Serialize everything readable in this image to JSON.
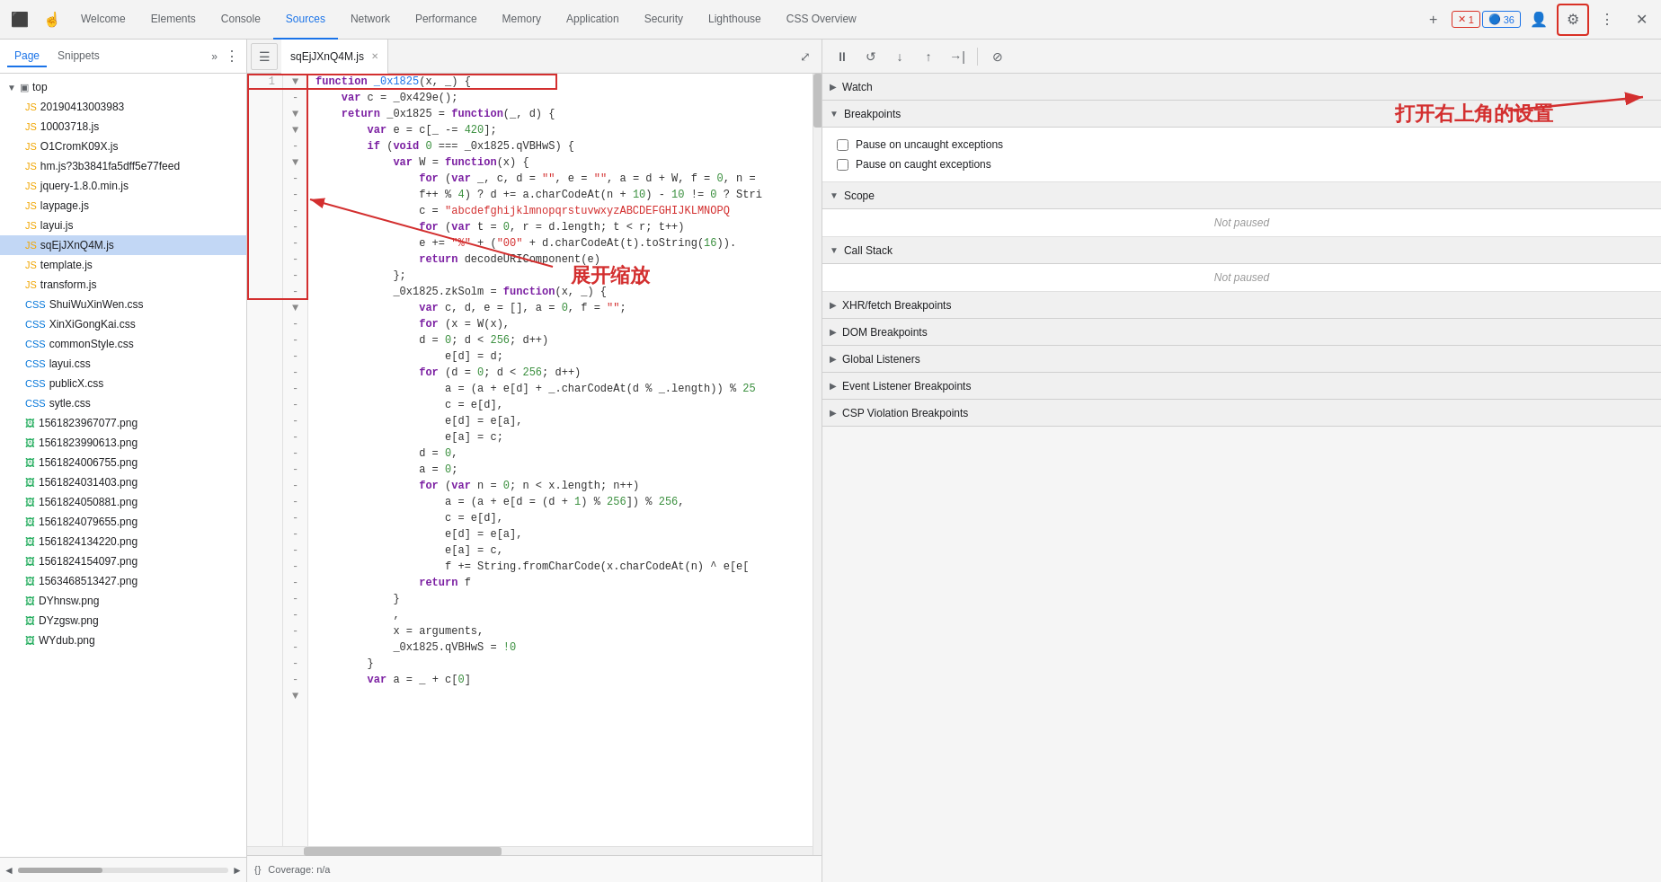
{
  "tabs": [
    {
      "label": "Welcome",
      "active": false
    },
    {
      "label": "Elements",
      "active": false
    },
    {
      "label": "Console",
      "active": false
    },
    {
      "label": "Sources",
      "active": true
    },
    {
      "label": "Network",
      "active": false
    },
    {
      "label": "Performance",
      "active": false
    },
    {
      "label": "Memory",
      "active": false
    },
    {
      "label": "Application",
      "active": false
    },
    {
      "label": "Security",
      "active": false
    },
    {
      "label": "Lighthouse",
      "active": false
    },
    {
      "label": "CSS Overview",
      "active": false
    }
  ],
  "toolbar": {
    "error_count": "1",
    "warning_count": "36"
  },
  "sidebar": {
    "tab_page": "Page",
    "tab_snippets": "Snippets",
    "root_label": "top",
    "files": [
      {
        "name": "20190413003983",
        "type": "js",
        "indent": 1
      },
      {
        "name": "10003718.js",
        "type": "js",
        "indent": 1
      },
      {
        "name": "O1CromK09X.js",
        "type": "js",
        "indent": 1
      },
      {
        "name": "hm.js?3b3841fa5dff5e77feed",
        "type": "js",
        "indent": 1
      },
      {
        "name": "jquery-1.8.0.min.js",
        "type": "js",
        "indent": 1
      },
      {
        "name": "laypage.js",
        "type": "js",
        "indent": 1
      },
      {
        "name": "layui.js",
        "type": "js",
        "indent": 1
      },
      {
        "name": "sqEjJXnQ4M.js",
        "type": "js",
        "indent": 1,
        "selected": true
      },
      {
        "name": "template.js",
        "type": "js",
        "indent": 1
      },
      {
        "name": "transform.js",
        "type": "js",
        "indent": 1
      },
      {
        "name": "ShuiWuXinWen.css",
        "type": "css",
        "indent": 1
      },
      {
        "name": "XinXiGongKai.css",
        "type": "css",
        "indent": 1
      },
      {
        "name": "commonStyle.css",
        "type": "css",
        "indent": 1
      },
      {
        "name": "layui.css",
        "type": "css",
        "indent": 1
      },
      {
        "name": "publicX.css",
        "type": "css",
        "indent": 1
      },
      {
        "name": "sytle.css",
        "type": "css",
        "indent": 1
      },
      {
        "name": "1561823967077.png",
        "type": "png",
        "indent": 1
      },
      {
        "name": "1561823990613.png",
        "type": "png",
        "indent": 1
      },
      {
        "name": "1561824006755.png",
        "type": "png",
        "indent": 1
      },
      {
        "name": "1561824031403.png",
        "type": "png",
        "indent": 1
      },
      {
        "name": "1561824050881.png",
        "type": "png",
        "indent": 1
      },
      {
        "name": "1561824079655.png",
        "type": "png",
        "indent": 1
      },
      {
        "name": "1561824134220.png",
        "type": "png",
        "indent": 1
      },
      {
        "name": "1561824154097.png",
        "type": "png",
        "indent": 1
      },
      {
        "name": "1563468513427.png",
        "type": "png",
        "indent": 1
      },
      {
        "name": "DYhnsw.png",
        "type": "png",
        "indent": 1
      },
      {
        "name": "DYzgsw.png",
        "type": "png",
        "indent": 1
      },
      {
        "name": "WYdub.png",
        "type": "png",
        "indent": 1
      }
    ]
  },
  "editor": {
    "tab_label": "sqEjJXnQ4M.js",
    "bottom_bar": "Coverage: n/a",
    "annotation_expand": "展开缩放",
    "annotation_settings": "打开右上角的设置"
  },
  "debugger": {
    "sections": {
      "watch_label": "Watch",
      "breakpoints_label": "Breakpoints",
      "pause_uncaught": "Pause on uncaught exceptions",
      "pause_caught": "Pause on caught exceptions",
      "scope_label": "Scope",
      "not_paused_1": "Not paused",
      "call_stack_label": "Call Stack",
      "not_paused_2": "Not paused",
      "xhr_label": "XHR/fetch Breakpoints",
      "dom_label": "DOM Breakpoints",
      "global_label": "Global Listeners",
      "event_label": "Event Listener Breakpoints",
      "csp_label": "CSP Violation Breakpoints"
    }
  },
  "code_lines": [
    {
      "num": "1",
      "arrow": "▼",
      "text": "function _0x1825(x, _) {"
    },
    {
      "num": "",
      "arrow": "-",
      "text": "    var c = _0x429e();"
    },
    {
      "num": "",
      "arrow": "-",
      "text": "    return _0x1825 = function(_, d) {"
    },
    {
      "num": "",
      "arrow": "▼",
      "text": "        var e = c[_ -= 420];"
    },
    {
      "num": "",
      "arrow": "-",
      "text": "        if (void 0 === _0x1825.qVBHwS) {"
    },
    {
      "num": "",
      "arrow": "▼",
      "text": "            var W = function(x) {"
    },
    {
      "num": "",
      "arrow": "-",
      "text": "                for (var _, c, d = \"\", e = \"\", a = d + W, f = 0, n ="
    },
    {
      "num": "",
      "arrow": "-",
      "text": "                f++ % 4) ? d += a.charCodeAt(n + 10) - 10 != 0 ? Stri"
    },
    {
      "num": "",
      "arrow": "-",
      "text": "                c = \"abcdefghijklmnopqrstuvwxyzABCDEFGHIJKLMNOPQ"
    },
    {
      "num": "",
      "arrow": "-",
      "text": "                for (var t = 0, r = d.length; t < r; t++)"
    },
    {
      "num": "",
      "arrow": "-",
      "text": "                e += \"%\" + (\"00\" + d.charCodeAt(t).toString(16))."
    },
    {
      "num": "",
      "arrow": "-",
      "text": "                return decodeURIComponent(e)"
    },
    {
      "num": "",
      "arrow": "-",
      "text": "            };"
    },
    {
      "num": "",
      "arrow": "-",
      "text": "            _0x1825.zkSolm = function(x, _) {"
    },
    {
      "num": "",
      "arrow": "▼",
      "text": "                var c, d, e = [], a = 0, f = \"\";"
    },
    {
      "num": "",
      "arrow": "-",
      "text": "                for (x = W(x),"
    },
    {
      "num": "",
      "arrow": "-",
      "text": "                d = 0; d < 256; d++)"
    },
    {
      "num": "",
      "arrow": "-",
      "text": "                    e[d] = d;"
    },
    {
      "num": "",
      "arrow": "-",
      "text": "                for (d = 0; d < 256; d++)"
    },
    {
      "num": "",
      "arrow": "-",
      "text": "                    a = (a + e[d] + _.charCodeAt(d % _.length)) % 25"
    },
    {
      "num": "",
      "arrow": "-",
      "text": "                    c = e[d],"
    },
    {
      "num": "",
      "arrow": "-",
      "text": "                    e[d] = e[a],"
    },
    {
      "num": "",
      "arrow": "-",
      "text": "                    e[a] = c;"
    },
    {
      "num": "",
      "arrow": "-",
      "text": "                d = 0,"
    },
    {
      "num": "",
      "arrow": "-",
      "text": "                a = 0;"
    },
    {
      "num": "",
      "arrow": "-",
      "text": "                for (var n = 0; n < x.length; n++)"
    },
    {
      "num": "",
      "arrow": "-",
      "text": "                    a = (a + e[d = (d + 1) % 256]) % 256,"
    },
    {
      "num": "",
      "arrow": "-",
      "text": "                    c = e[d],"
    },
    {
      "num": "",
      "arrow": "-",
      "text": "                    e[d] = e[a],"
    },
    {
      "num": "",
      "arrow": "-",
      "text": "                    e[a] = c,"
    },
    {
      "num": "",
      "arrow": "-",
      "text": "                    f += String.fromCharCode(x.charCodeAt(n) ^ e[e["
    },
    {
      "num": "",
      "arrow": "-",
      "text": "                return f"
    },
    {
      "num": "",
      "arrow": "-",
      "text": "            }"
    },
    {
      "num": "",
      "arrow": "-",
      "text": "            ,"
    },
    {
      "num": "",
      "arrow": "-",
      "text": "            x = arguments,"
    },
    {
      "num": "",
      "arrow": "-",
      "text": "            _0x1825.qVBHwS = !0"
    },
    {
      "num": "",
      "arrow": "-",
      "text": "        }"
    },
    {
      "num": "",
      "arrow": "-",
      "text": "        var a = _ + c[0]"
    }
  ]
}
